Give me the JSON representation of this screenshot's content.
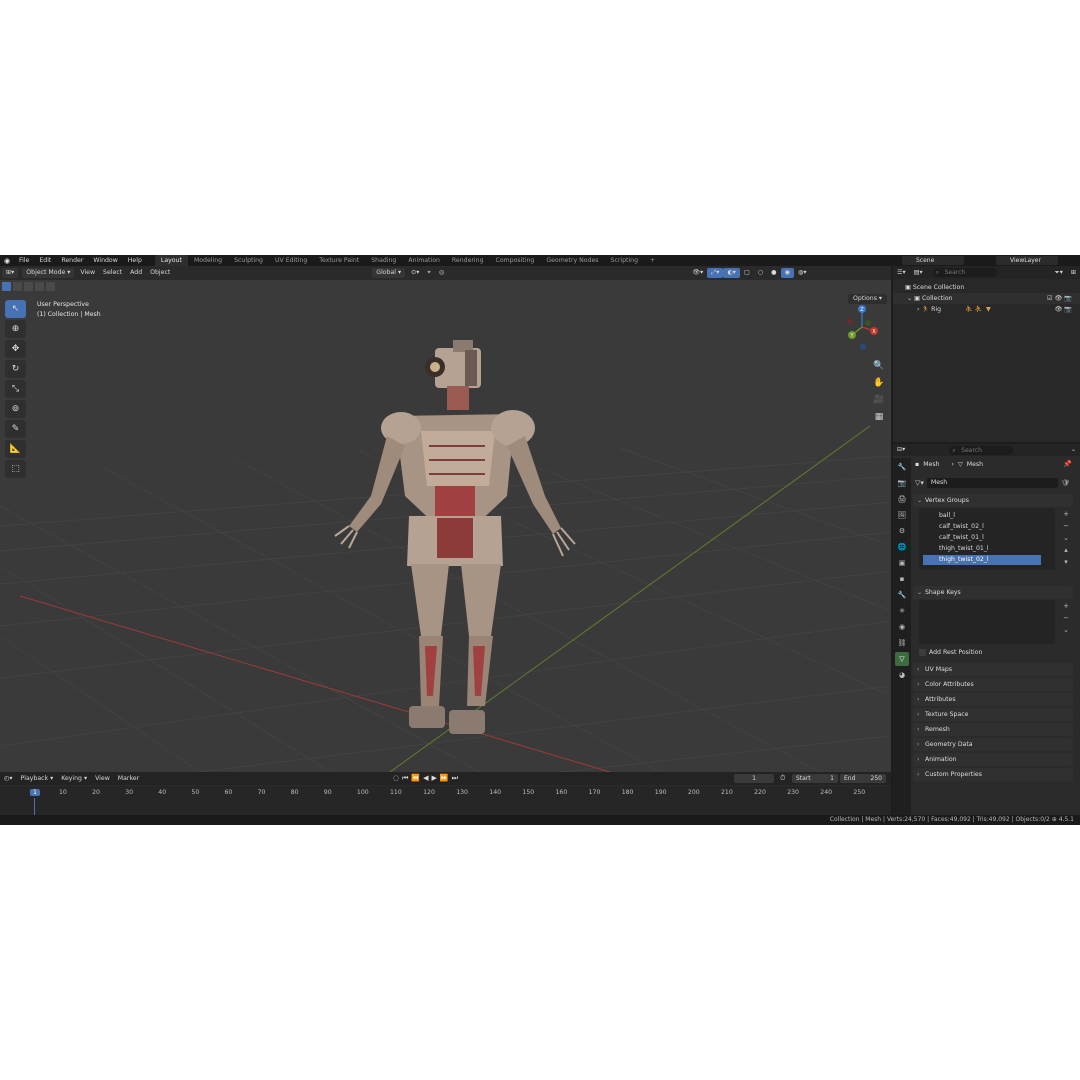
{
  "topbar": {
    "menus": [
      "File",
      "Edit",
      "Render",
      "Window",
      "Help"
    ],
    "workspaces": [
      "Layout",
      "Modeling",
      "Sculpting",
      "UV Editing",
      "Texture Paint",
      "Shading",
      "Animation",
      "Rendering",
      "Compositing",
      "Geometry Nodes",
      "Scripting"
    ],
    "active_workspace": "Layout",
    "add_tab": "+",
    "scene": "Scene",
    "view_layer": "ViewLayer"
  },
  "viewport": {
    "mode": "Object Mode",
    "menus": [
      "View",
      "Select",
      "Add",
      "Object"
    ],
    "transform_orientation": "Global",
    "overlay_line1": "User Perspective",
    "overlay_line2": "(1) Collection | Mesh",
    "options": "Options",
    "gizmo": {
      "z": "Z",
      "y": "Y",
      "x": "X"
    }
  },
  "timeline": {
    "menus": [
      "Playback",
      "Keying",
      "View",
      "Marker"
    ],
    "current_frame": "1",
    "start_label": "Start",
    "start": "1",
    "end_label": "End",
    "end": "250",
    "ticks": [
      "1",
      "10",
      "20",
      "30",
      "40",
      "50",
      "60",
      "70",
      "80",
      "90",
      "100",
      "110",
      "120",
      "130",
      "140",
      "150",
      "160",
      "170",
      "180",
      "190",
      "200",
      "210",
      "220",
      "230",
      "240",
      "250"
    ]
  },
  "status": {
    "text": "Collection | Mesh | Verts:24,570 | Faces:49,092 | Tris:49,092 | Objects:0/2",
    "version": "4.5.1"
  },
  "outliner": {
    "search_placeholder": "Search",
    "scene_collection": "Scene Collection",
    "collection": "Collection",
    "rig": "Rig"
  },
  "properties": {
    "search_placeholder": "Search",
    "breadcrumb_object": "Mesh",
    "breadcrumb_data": "Mesh",
    "data_name": "Mesh",
    "vertex_groups_title": "Vertex Groups",
    "vertex_groups": [
      "ball_l",
      "calf_twist_02_l",
      "calf_twist_01_l",
      "thigh_twist_01_l",
      "thigh_twist_02_l"
    ],
    "selected_group": "thigh_twist_02_l",
    "shape_keys_title": "Shape Keys",
    "add_rest_position": "Add Rest Position",
    "panels": [
      "UV Maps",
      "Color Attributes",
      "Attributes",
      "Texture Space",
      "Remesh",
      "Geometry Data",
      "Animation",
      "Custom Properties"
    ]
  },
  "colors": {
    "accent": "#4772b3",
    "x_axis": "#c0392b",
    "y_axis": "#6f9a2a",
    "z_axis": "#3b7bd4"
  }
}
